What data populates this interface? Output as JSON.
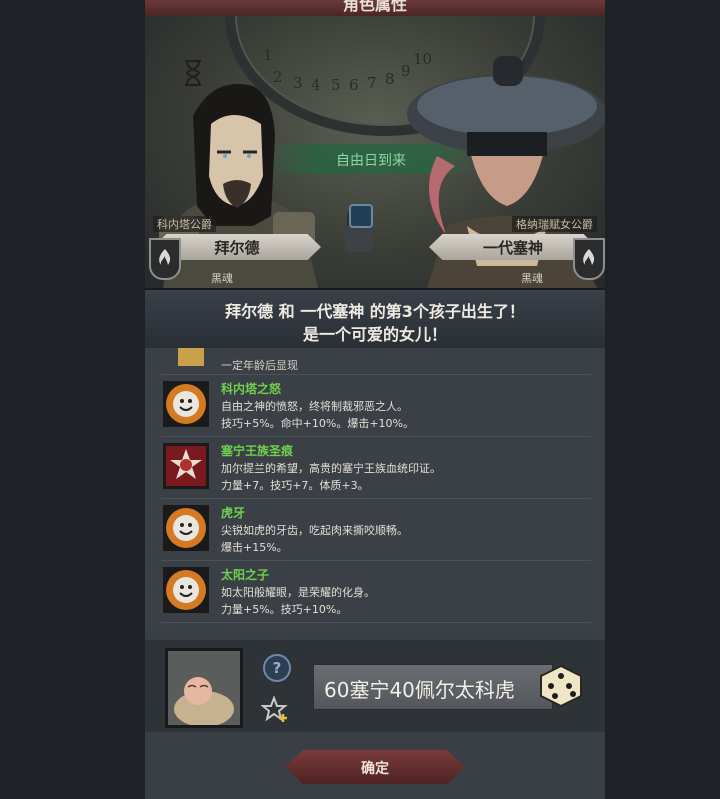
{
  "header": {
    "title": "角色属性"
  },
  "scene": {
    "dial_numbers": [
      "1",
      "2",
      "3",
      "4",
      "5",
      "6",
      "7",
      "8",
      "9",
      "10"
    ],
    "banner_text": "自由日到来"
  },
  "parents": {
    "left": {
      "title": "科内塔公爵",
      "name": "拜尔德",
      "soul": "黑魂"
    },
    "right": {
      "title": "格纳瑞赋女公爵",
      "name": "一代塞神",
      "soul": "黑魂"
    }
  },
  "announcement": {
    "line1": "拜尔德 和 一代塞神 的第3个孩子出生了！",
    "line2": "是一个可爱的女儿！"
  },
  "traits": {
    "first_row_text": "一定年龄后显现",
    "items": [
      {
        "name": "科内塔之怒",
        "desc": "自由之神的愤怒，终将制裁邪恶之人。",
        "stats": "技巧+5%。命中+10%。爆击+10%。",
        "icon": "sun-face-icon"
      },
      {
        "name": "塞宁王族圣痕",
        "desc": "加尔提兰的希望，高贵的塞宁王族血统印证。",
        "stats": "力量+7。技巧+7。体质+3。",
        "icon": "royal-sigil-icon"
      },
      {
        "name": "虎牙",
        "desc": "尖锐如虎的牙齿，吃起肉来撕咬顺畅。",
        "stats": "爆击+15%。",
        "icon": "sun-face-icon"
      },
      {
        "name": "太阳之子",
        "desc": "如太阳般耀眼，是荣耀的化身。",
        "stats": "力量+5%。技巧+10%。",
        "icon": "sun-face-icon"
      }
    ]
  },
  "baby": {
    "question_label": "?",
    "name_value": "60塞宁40佩尔太科虎"
  },
  "footer": {
    "confirm_label": "确定"
  },
  "colors": {
    "trait_name": "#6fcf4e",
    "confirm_bg": "#6a3132",
    "panel_bg": "#3b4046"
  }
}
